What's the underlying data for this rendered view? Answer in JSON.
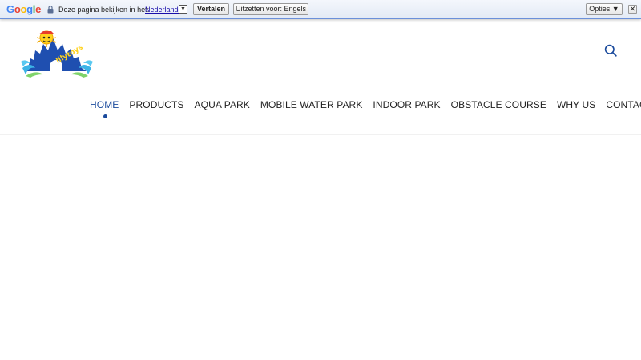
{
  "translate_bar": {
    "logo_text": "Google",
    "prompt": "Deze pagina bekijken in het:",
    "language": "Nederlands",
    "language_arrow": "▼",
    "translate_button": "Vertalen",
    "disable_button": "Uitzetten voor: Engels",
    "options_button": "Opties ▼",
    "close_button": "✕"
  },
  "header": {
    "logo_text": "lilytoys",
    "search_icon": "search-icon"
  },
  "nav": {
    "items": [
      {
        "label": "HOME",
        "active": true
      },
      {
        "label": "PRODUCTS"
      },
      {
        "label": "AQUA PARK"
      },
      {
        "label": "MOBILE WATER PARK"
      },
      {
        "label": "INDOOR PARK"
      },
      {
        "label": "OBSTACLE COURSE"
      },
      {
        "label": "WHY US"
      },
      {
        "label": "CONTACT US"
      }
    ]
  },
  "colors": {
    "accent": "#1a4a9c",
    "nav_text": "#222222",
    "translate_bar_border": "#6b90da"
  }
}
